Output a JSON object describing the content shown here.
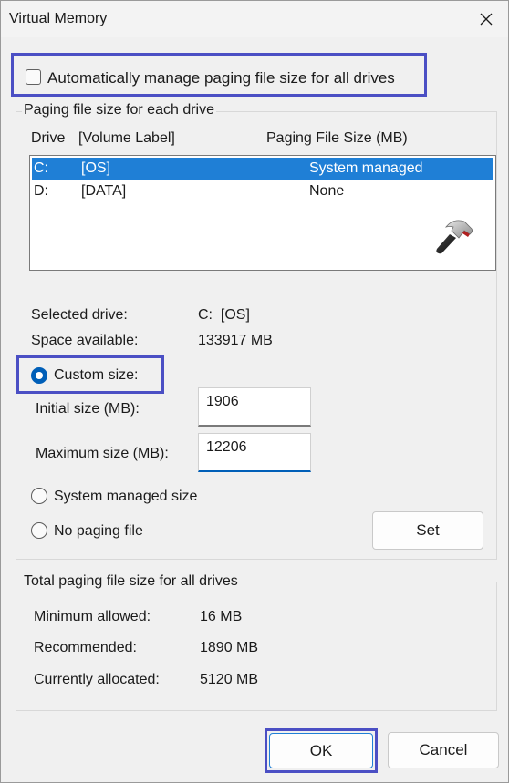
{
  "window": {
    "title": "Virtual Memory",
    "close_icon": "close-icon"
  },
  "auto_manage": {
    "label": "Automatically manage paging file size for all drives",
    "checked": false
  },
  "paging_group": {
    "title": "Paging file size for each drive",
    "columns": {
      "drive": "Drive",
      "volume_label": "[Volume Label]",
      "paging_size": "Paging File Size (MB)"
    },
    "drives": [
      {
        "drive": "C:",
        "label": "[OS]",
        "size": "System managed",
        "selected": true
      },
      {
        "drive": "D:",
        "label": "[DATA]",
        "size": "None",
        "selected": false
      }
    ],
    "watermark_icon": "hammer-icon",
    "selected_drive_label": "Selected drive:",
    "selected_drive_value": "C:  [OS]",
    "space_available_label": "Space available:",
    "space_available_value": "133917 MB",
    "custom_size_label": "Custom size:",
    "initial_size_label": "Initial size (MB):",
    "initial_size_value": "1906",
    "max_size_label": "Maximum size (MB):",
    "max_size_value": "12206",
    "system_managed_label": "System managed size",
    "no_paging_label": "No paging file",
    "set_button": "Set"
  },
  "total_group": {
    "title": "Total paging file size for all drives",
    "min_allowed_label": "Minimum allowed:",
    "min_allowed_value": "16 MB",
    "recommended_label": "Recommended:",
    "recommended_value": "1890 MB",
    "currently_allocated_label": "Currently allocated:",
    "currently_allocated_value": "5120 MB"
  },
  "footer": {
    "ok_button": "OK",
    "cancel_button": "Cancel"
  },
  "colors": {
    "highlight": "#4b4fc4",
    "selection": "#1f7fd6",
    "accent": "#005fb8"
  }
}
